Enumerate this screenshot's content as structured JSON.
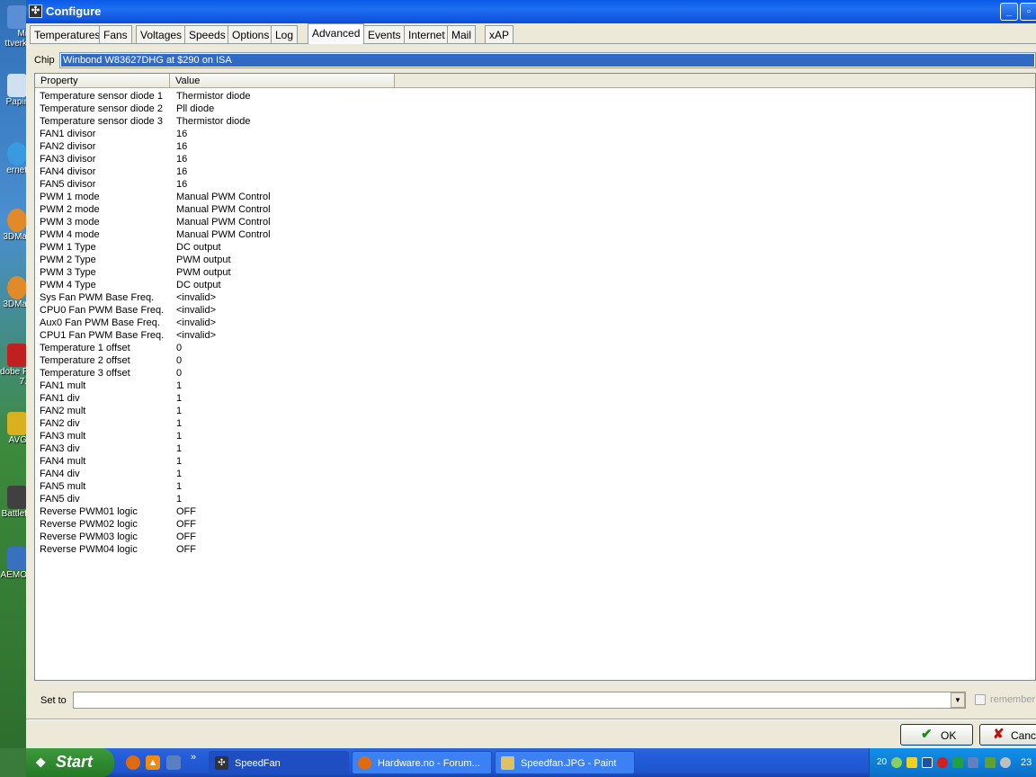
{
  "window": {
    "title": "Configure"
  },
  "tabs": [
    "Temperatures",
    "Fans",
    "Voltages",
    "Speeds",
    "Options",
    "Log",
    "Advanced",
    "Events",
    "Internet",
    "Mail",
    "xAP"
  ],
  "active_tab": "Advanced",
  "chip": {
    "label": "Chip",
    "value": "Winbond W83627DHG at $290 on ISA"
  },
  "table": {
    "headers": {
      "property": "Property",
      "value": "Value"
    },
    "rows": [
      {
        "property": "Temperature sensor diode 1",
        "value": "Thermistor diode"
      },
      {
        "property": "Temperature sensor diode 2",
        "value": "Pll diode"
      },
      {
        "property": "Temperature sensor diode 3",
        "value": "Thermistor diode"
      },
      {
        "property": "FAN1 divisor",
        "value": "16"
      },
      {
        "property": "FAN2 divisor",
        "value": "16"
      },
      {
        "property": "FAN3 divisor",
        "value": "16"
      },
      {
        "property": "FAN4 divisor",
        "value": "16"
      },
      {
        "property": "FAN5 divisor",
        "value": "16"
      },
      {
        "property": "PWM 1 mode",
        "value": "Manual PWM Control"
      },
      {
        "property": "PWM 2 mode",
        "value": "Manual PWM Control"
      },
      {
        "property": "PWM 3 mode",
        "value": "Manual PWM Control"
      },
      {
        "property": "PWM 4 mode",
        "value": "Manual PWM Control"
      },
      {
        "property": "PWM 1 Type",
        "value": "DC output"
      },
      {
        "property": "PWM 2 Type",
        "value": "PWM output"
      },
      {
        "property": "PWM 3 Type",
        "value": "PWM output"
      },
      {
        "property": "PWM 4 Type",
        "value": "DC output"
      },
      {
        "property": "Sys Fan PWM Base Freq.",
        "value": "<invalid>"
      },
      {
        "property": "CPU0 Fan PWM Base Freq.",
        "value": "<invalid>"
      },
      {
        "property": "Aux0 Fan PWM Base Freq.",
        "value": "<invalid>"
      },
      {
        "property": "CPU1 Fan PWM Base Freq.",
        "value": "<invalid>"
      },
      {
        "property": "Temperature 1 offset",
        "value": "0"
      },
      {
        "property": "Temperature 2 offset",
        "value": "0"
      },
      {
        "property": "Temperature 3 offset",
        "value": "0"
      },
      {
        "property": "FAN1 mult",
        "value": "1"
      },
      {
        "property": "FAN1 div",
        "value": "1"
      },
      {
        "property": "FAN2 mult",
        "value": "1"
      },
      {
        "property": "FAN2 div",
        "value": "1"
      },
      {
        "property": "FAN3 mult",
        "value": "1"
      },
      {
        "property": "FAN3 div",
        "value": "1"
      },
      {
        "property": "FAN4 mult",
        "value": "1"
      },
      {
        "property": "FAN4 div",
        "value": "1"
      },
      {
        "property": "FAN5 mult",
        "value": "1"
      },
      {
        "property": "FAN5 div",
        "value": "1"
      },
      {
        "property": "Reverse PWM01 logic",
        "value": "OFF"
      },
      {
        "property": "Reverse PWM02 logic",
        "value": "OFF"
      },
      {
        "property": "Reverse PWM03 logic",
        "value": "OFF"
      },
      {
        "property": "Reverse PWM04 logic",
        "value": "OFF"
      }
    ]
  },
  "set_to": {
    "label": "Set to",
    "value": "",
    "remember_label": "remember i"
  },
  "buttons": {
    "ok": "OK",
    "cancel": "Cance"
  },
  "desktop_icons": [
    "Mi\nttverk",
    "Papir",
    "ernet",
    "3DMa",
    "3DMa",
    "dobe F\n7.",
    "AVG",
    "Battlef",
    "AEMO"
  ],
  "taskbar": {
    "start": "Start",
    "tasks": [
      {
        "label": "SpeedFan",
        "active": true
      },
      {
        "label": "Hardware.no - Forum...",
        "active": false
      },
      {
        "label": "Speedfan.JPG - Paint",
        "active": false
      }
    ],
    "quicklaunch_more": "»",
    "tray_number": "20",
    "clock": "23"
  },
  "colors": {
    "titlebar": "#0a5ae8",
    "selection": "#316ac5",
    "window_bg": "#ece9d8",
    "taskbar": "#245edb",
    "start": "#3c8a3c"
  }
}
